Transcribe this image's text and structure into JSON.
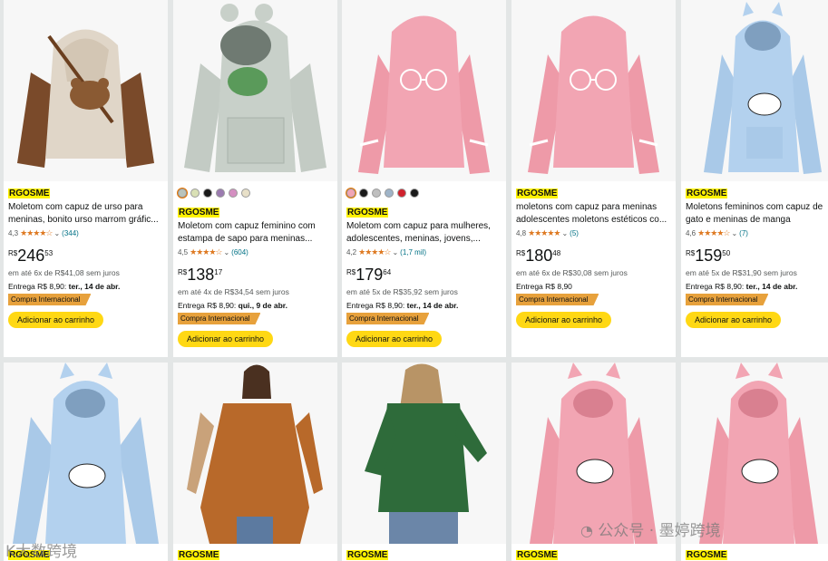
{
  "colors": {
    "brand_highlight": "#fff200",
    "button": "#ffd814",
    "international_badge": "#e7a13c",
    "star": "#de7921",
    "link": "#007185"
  },
  "row1": [
    {
      "brand": "RGOSME",
      "title": "Moletom com capuz de urso para meninas, bonito urso marrom gráfic...",
      "rating": "4,3",
      "reviews": "(344)",
      "currency": "R$",
      "price_whole": "246",
      "price_frac": "53",
      "installments": "em até 6x de R$41,08 sem juros",
      "delivery_prefix": "Entrega R$ 8,90:",
      "delivery_date": "ter., 14 de abr.",
      "badge": "Compra Internacional",
      "button": "Adicionar ao carrinho"
    },
    {
      "brand": "RGOSME",
      "title": "Moletom com capuz feminino com estampa de sapo para meninas...",
      "rating": "4,5",
      "reviews": "(604)",
      "currency": "R$",
      "price_whole": "138",
      "price_frac": "17",
      "installments": "em até 4x de R$34,54 sem juros",
      "delivery_prefix": "Entrega R$ 8,90:",
      "delivery_date": "qui., 9 de abr.",
      "badge": "Compra Internacional",
      "button": "Adicionar ao carrinho",
      "swatches": [
        "#b9c4bd",
        "#d9e0b5",
        "#1a1a1a",
        "#9b7bb0",
        "#d48fc1",
        "#e8e0c8"
      ]
    },
    {
      "brand": "RGOSME",
      "title": "Moletom com capuz para mulheres, adolescentes, meninas, jovens,...",
      "rating": "4,2",
      "reviews": "(1,7 mil)",
      "currency": "R$",
      "price_whole": "179",
      "price_frac": "64",
      "installments": "em até 5x de R$35,92 sem juros",
      "delivery_prefix": "Entrega R$ 8,90:",
      "delivery_date": "ter., 14 de abr.",
      "badge": "Compra Internacional",
      "button": "Adicionar ao carrinho",
      "swatches": [
        "#f2a5b5",
        "#1a1a1a",
        "#bfbfbf",
        "#9fb4c8",
        "#d0212d",
        "#1a1a1a"
      ]
    },
    {
      "brand": "RGOSME",
      "title": "moletons com capuz para meninas adolescentes moletons estéticos co...",
      "rating": "4,8",
      "reviews": "(5)",
      "currency": "R$",
      "price_whole": "180",
      "price_frac": "48",
      "installments": "em até 6x de R$30,08 sem juros",
      "delivery_prefix": "Entrega R$ 8,90",
      "delivery_date": "",
      "badge": "Compra Internacional",
      "button": "Adicionar ao carrinho"
    },
    {
      "brand": "RGOSME",
      "title": "Moletons femininos com capuz de gato e meninas de manga comprida",
      "rating": "4,6",
      "reviews": "(7)",
      "currency": "R$",
      "price_whole": "159",
      "price_frac": "50",
      "installments": "em até 5x de R$31,90 sem juros",
      "delivery_prefix": "Entrega R$ 8,90:",
      "delivery_date": "ter., 14 de abr.",
      "badge": "Compra Internacional",
      "button": "Adicionar ao carrinho"
    }
  ],
  "row2": [
    {
      "brand": "RGOSME"
    },
    {
      "brand": "RGOSME"
    },
    {
      "brand": "RGOSME"
    },
    {
      "brand": "RGOSME"
    },
    {
      "brand": "RGOSME"
    }
  ],
  "watermarks": {
    "left": "K大数跨境",
    "right": "公众号 · 墨婷跨境"
  }
}
